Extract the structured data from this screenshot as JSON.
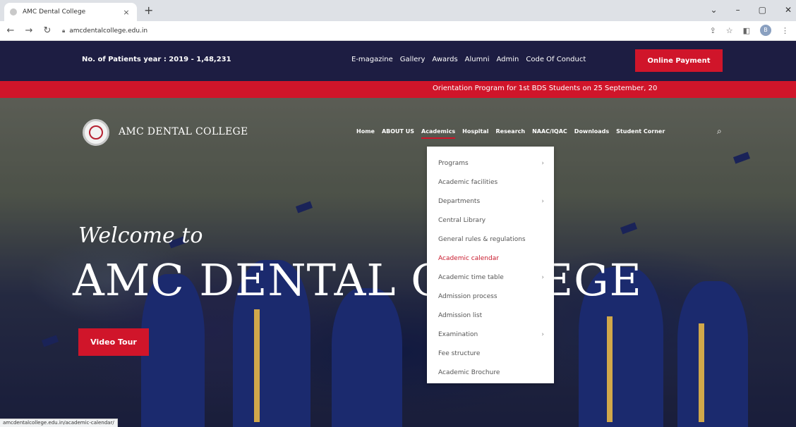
{
  "browser": {
    "tab_title": "AMC Dental College",
    "tab_close": "×",
    "new_tab": "+",
    "url": "amcdentalcollege.edu.in",
    "status_url": "amcdentalcollege.edu.in/academic-calendar/",
    "profile_initial": "B",
    "window_controls": [
      "⌄",
      "–",
      "▢",
      "✕"
    ]
  },
  "topbar": {
    "patients_label": "No. of Patients year : 2019 - 1,48,231",
    "links": [
      "E-magazine",
      "Gallery",
      "Awards",
      "Alumni",
      "Admin",
      "Code Of Conduct"
    ],
    "payment_label": "Online Payment",
    "accent": "#d0152a",
    "bg": "#1d1d42"
  },
  "ticker": {
    "text": "Orientation Program for 1st BDS Students on 25 September, 20"
  },
  "header": {
    "brand": "AMC DENTAL COLLEGE",
    "nav": [
      "Home",
      "ABOUT US",
      "Academics",
      "Hospital",
      "Research",
      "NAAC/IQAC",
      "Downloads",
      "Student Corner"
    ]
  },
  "hero": {
    "welcome": "Welcome to",
    "title": "AMC DENTAL COLLEGE",
    "video_label": "Video Tour"
  },
  "dropdown": {
    "items": [
      {
        "label": "Programs",
        "submenu": true
      },
      {
        "label": "Academic facilities",
        "submenu": false
      },
      {
        "label": "Departments",
        "submenu": true
      },
      {
        "label": "Central Library",
        "submenu": false
      },
      {
        "label": "General rules & regulations",
        "submenu": false
      },
      {
        "label": "Academic calendar",
        "submenu": false,
        "active": true
      },
      {
        "label": "Academic time table",
        "submenu": true
      },
      {
        "label": "Admission process",
        "submenu": false
      },
      {
        "label": "Admission list",
        "submenu": false
      },
      {
        "label": "Examination",
        "submenu": true
      },
      {
        "label": "Fee structure",
        "submenu": false
      },
      {
        "label": "Academic Brochure",
        "submenu": false
      }
    ]
  }
}
